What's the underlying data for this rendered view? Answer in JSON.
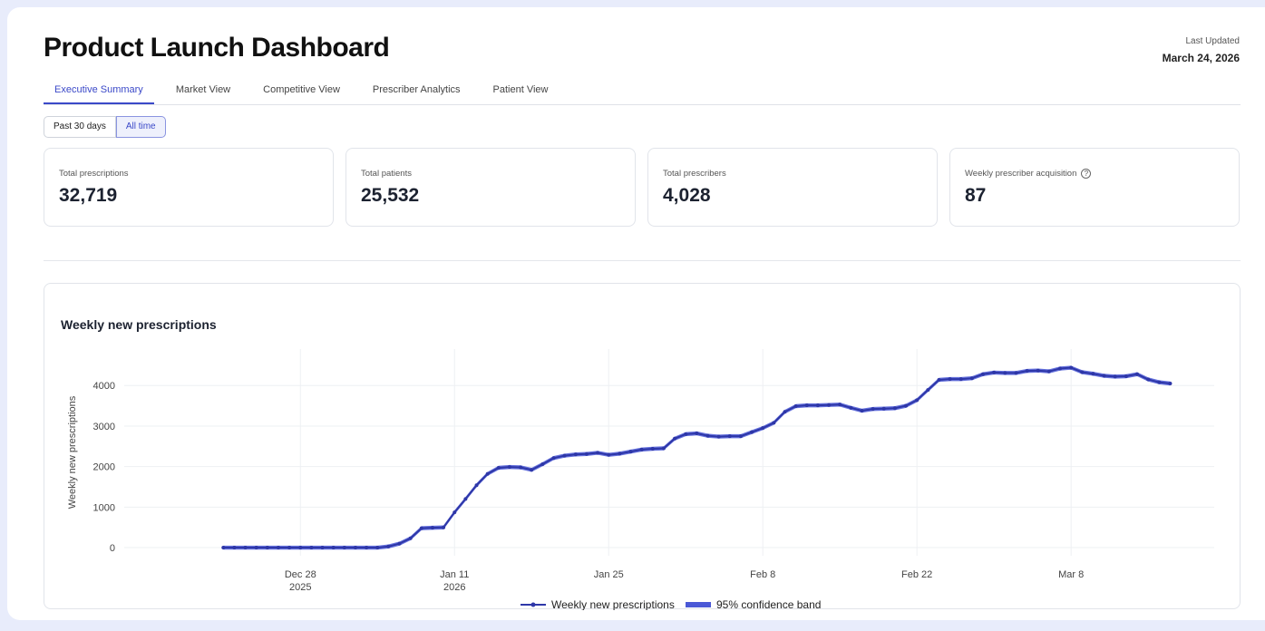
{
  "header": {
    "title": "Product Launch Dashboard",
    "last_updated_label": "Last Updated",
    "last_updated_value": "March 24, 2026"
  },
  "tabs": [
    {
      "label": "Executive Summary",
      "active": true
    },
    {
      "label": "Market View",
      "active": false
    },
    {
      "label": "Competitive View",
      "active": false
    },
    {
      "label": "Prescriber Analytics",
      "active": false
    },
    {
      "label": "Patient View",
      "active": false
    }
  ],
  "range": {
    "past30": "Past 30 days",
    "all": "All time",
    "selected": "All time"
  },
  "kpis": [
    {
      "label": "Total prescriptions",
      "value": "32,719"
    },
    {
      "label": "Total patients",
      "value": "25,532"
    },
    {
      "label": "Total prescribers",
      "value": "4,028"
    },
    {
      "label": "Weekly prescriber acquisition",
      "value": "87",
      "help_icon": "help-circle-icon"
    }
  ],
  "colors": {
    "accent": "#3b49c8",
    "line": "#2e37a8",
    "band": "#4a58d6"
  },
  "chart_data": {
    "type": "line",
    "title": "Weekly new prescriptions",
    "ylabel": "Weekly new prescriptions",
    "xlabel": "",
    "ylim": [
      -200,
      4900
    ],
    "yticks": [
      0,
      1000,
      2000,
      3000,
      4000
    ],
    "xticks": [
      {
        "date": "2025-12-28",
        "label": "Dec 28",
        "sub": "2025"
      },
      {
        "date": "2026-01-11",
        "label": "Jan 11",
        "sub": "2026"
      },
      {
        "date": "2026-01-25",
        "label": "Jan 25",
        "sub": ""
      },
      {
        "date": "2026-02-08",
        "label": "Feb 8",
        "sub": ""
      },
      {
        "date": "2026-02-22",
        "label": "Feb 22",
        "sub": ""
      },
      {
        "date": "2026-03-08",
        "label": "Mar 8",
        "sub": ""
      }
    ],
    "grid": true,
    "legend_position": "bottom-center",
    "series": [
      {
        "name": "Weekly new prescriptions",
        "x": [
          "2025-12-21",
          "2025-12-22",
          "2025-12-23",
          "2025-12-24",
          "2025-12-25",
          "2025-12-26",
          "2025-12-27",
          "2025-12-28",
          "2025-12-29",
          "2025-12-30",
          "2025-12-31",
          "2026-01-01",
          "2026-01-02",
          "2026-01-03",
          "2026-01-04",
          "2026-01-05",
          "2026-01-06",
          "2026-01-07",
          "2026-01-08",
          "2026-01-09",
          "2026-01-10",
          "2026-01-11",
          "2026-01-12",
          "2026-01-13",
          "2026-01-14",
          "2026-01-15",
          "2026-01-16",
          "2026-01-17",
          "2026-01-18",
          "2026-01-19",
          "2026-01-20",
          "2026-01-21",
          "2026-01-22",
          "2026-01-23",
          "2026-01-24",
          "2026-01-25",
          "2026-01-26",
          "2026-01-27",
          "2026-01-28",
          "2026-01-29",
          "2026-01-30",
          "2026-01-31",
          "2026-02-01",
          "2026-02-02",
          "2026-02-03",
          "2026-02-04",
          "2026-02-05",
          "2026-02-06",
          "2026-02-07",
          "2026-02-08",
          "2026-02-09",
          "2026-02-10",
          "2026-02-11",
          "2026-02-12",
          "2026-02-13",
          "2026-02-14",
          "2026-02-15",
          "2026-02-16",
          "2026-02-17",
          "2026-02-18",
          "2026-02-19",
          "2026-02-20",
          "2026-02-21",
          "2026-02-22",
          "2026-02-23",
          "2026-02-24",
          "2026-02-25",
          "2026-02-26",
          "2026-02-27",
          "2026-02-28",
          "2026-03-01",
          "2026-03-02",
          "2026-03-03",
          "2026-03-04",
          "2026-03-05",
          "2026-03-06",
          "2026-03-07",
          "2026-03-08",
          "2026-03-09",
          "2026-03-10",
          "2026-03-11",
          "2026-03-12",
          "2026-03-13",
          "2026-03-14",
          "2026-03-15",
          "2026-03-16",
          "2026-03-17"
        ],
        "values": [
          0,
          0,
          0,
          0,
          0,
          0,
          0,
          0,
          0,
          0,
          0,
          0,
          0,
          0,
          0,
          30,
          100,
          230,
          480,
          490,
          500,
          870,
          1200,
          1540,
          1820,
          1970,
          1990,
          1980,
          1920,
          2060,
          2210,
          2270,
          2300,
          2310,
          2340,
          2290,
          2320,
          2370,
          2420,
          2440,
          2450,
          2690,
          2800,
          2820,
          2760,
          2740,
          2750,
          2750,
          2850,
          2950,
          3080,
          3350,
          3490,
          3510,
          3510,
          3520,
          3530,
          3450,
          3380,
          3420,
          3430,
          3440,
          3500,
          3640,
          3890,
          4140,
          4160,
          4160,
          4180,
          4280,
          4320,
          4310,
          4310,
          4360,
          4370,
          4350,
          4420,
          4440,
          4330,
          4290,
          4240,
          4220,
          4230,
          4280,
          4150,
          4080,
          4050
        ]
      },
      {
        "name": "95% confidence band",
        "band_halfwidth": 50
      }
    ]
  }
}
